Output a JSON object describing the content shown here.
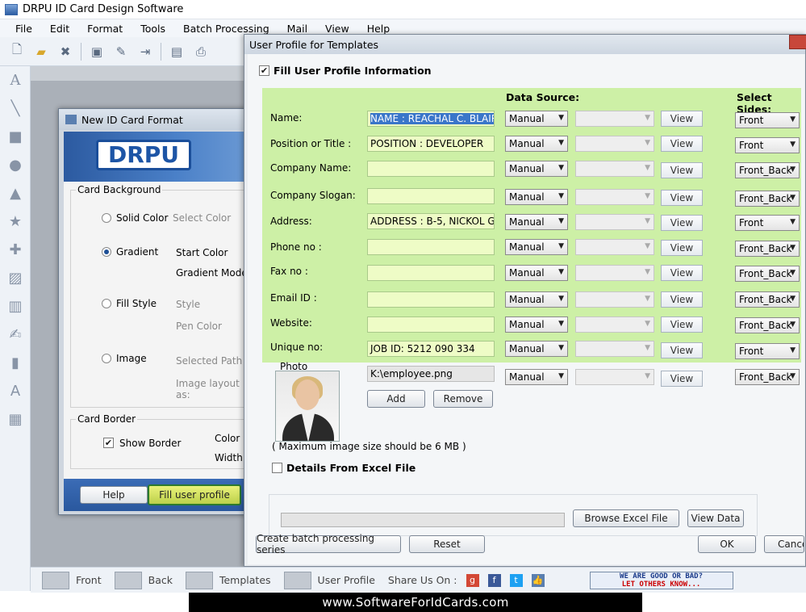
{
  "app": {
    "title": "DRPU ID Card Design Software"
  },
  "menu": [
    "File",
    "Edit",
    "Format",
    "Tools",
    "Batch Processing",
    "Mail",
    "View",
    "Help"
  ],
  "new_card_dialog": {
    "title": "New ID Card Format",
    "logo_text": "DRPU",
    "card_background_label": "Card Background",
    "solid_color": "Solid Color",
    "select_color": "Select Color",
    "gradient": "Gradient",
    "start_color": "Start Color",
    "gradient_mode": "Gradient Mode",
    "fill_style": "Fill Style",
    "style": "Style",
    "pen_color": "Pen Color",
    "image": "Image",
    "selected_path": "Selected Path",
    "image_layout": "Image layout as:",
    "card_border_label": "Card Border",
    "show_border": "Show Border",
    "color": "Color",
    "width": "Width",
    "help_button": "Help",
    "fill_profile_button": "Fill user profile"
  },
  "profile_dialog": {
    "title": "User Profile for Templates",
    "fill_info_label": "Fill User Profile Information",
    "data_source_header": "Data Source:",
    "select_sides_header": "Select Sides:",
    "view_label": "View",
    "fields": [
      {
        "label": "Name:",
        "value": "NAME :    REACHAL C. BLAIR",
        "source": "Manual",
        "side": "Front"
      },
      {
        "label": "Position or Title :",
        "value": "POSITION :  DEVELOPER",
        "source": "Manual",
        "side": "Front"
      },
      {
        "label": "Company Name:",
        "value": "",
        "source": "Manual",
        "side": "Front_Back"
      },
      {
        "label": "Company Slogan:",
        "value": "",
        "source": "Manual",
        "side": "Front_Back"
      },
      {
        "label": "Address:",
        "value": "ADDRESS :   B-5, NICKOL GAR",
        "source": "Manual",
        "side": "Front"
      },
      {
        "label": "Phone no :",
        "value": "",
        "source": "Manual",
        "side": "Front_Back"
      },
      {
        "label": "Fax no :",
        "value": "",
        "source": "Manual",
        "side": "Front_Back"
      },
      {
        "label": "Email ID :",
        "value": "",
        "source": "Manual",
        "side": "Front_Back"
      },
      {
        "label": "Website:",
        "value": "",
        "source": "Manual",
        "side": "Front_Back"
      },
      {
        "label": "Unique no:",
        "value": "JOB ID: 5212 090 334",
        "source": "Manual",
        "side": "Front"
      }
    ],
    "photo_label": "Photo",
    "photo_path": "K:\\employee.png",
    "photo_source": "Manual",
    "photo_side": "Front_Back",
    "add_button": "Add",
    "remove_button": "Remove",
    "max_size_note": "( Maximum image size should be 6 MB )",
    "excel_label": "Details From Excel File",
    "browse_excel": "Browse Excel File",
    "view_data": "View Data",
    "batch_button": "Create batch processing series",
    "reset_button": "Reset",
    "ok_button": "OK",
    "cancel_button": "Cance"
  },
  "statusbar": {
    "front": "Front",
    "back": "Back",
    "templates": "Templates",
    "user_profile": "User Profile",
    "share": "Share Us On :",
    "banner_line1": "WE ARE GOOD OR BAD?",
    "banner_line2": "LET OTHERS KNOW..."
  },
  "footer": "www.SoftwareForIdCards.com"
}
